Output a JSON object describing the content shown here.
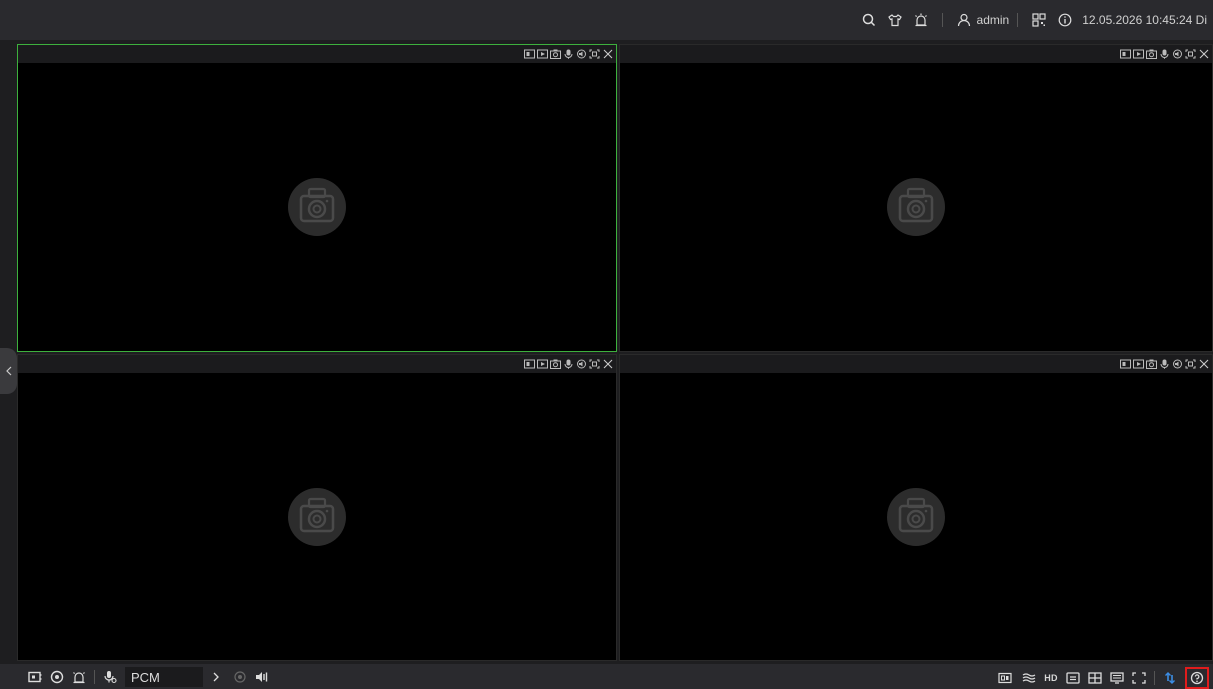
{
  "topbar": {
    "icons": [
      "search-icon",
      "shirt-icon",
      "alarm-icon",
      "user-icon",
      "qrcode-icon",
      "info-icon"
    ],
    "user": "admin",
    "datetime": "12.05.2026 10:45:24 Di"
  },
  "tiles": [
    {
      "id": 1,
      "selected": true
    },
    {
      "id": 2,
      "selected": false
    },
    {
      "id": 3,
      "selected": false
    },
    {
      "id": 4,
      "selected": false
    }
  ],
  "tile_header_icons": [
    "stream-icon",
    "playback-icon",
    "snapshot-icon",
    "mic-icon",
    "audio-icon",
    "fullscreen-icon",
    "close-icon"
  ],
  "bottombar": {
    "audio_format": "PCM",
    "left_icons": [
      "screen-icon",
      "record-icon",
      "alarm-icon",
      "talk-icon",
      "arrow-right-icon",
      "record-dot-icon",
      "volume-icon"
    ],
    "right_icons": [
      "ratio-icon",
      "wave-icon",
      "hd-label",
      "single-layout-icon",
      "quad-layout-icon",
      "multi-layout-icon",
      "fullscreen-icon",
      "transfer-icon",
      "help-icon"
    ],
    "hd_text": "HD"
  },
  "colors": {
    "selected_border": "#3db03d",
    "highlight_box": "#e01c1c",
    "accent_blue": "#3c8ee6"
  }
}
